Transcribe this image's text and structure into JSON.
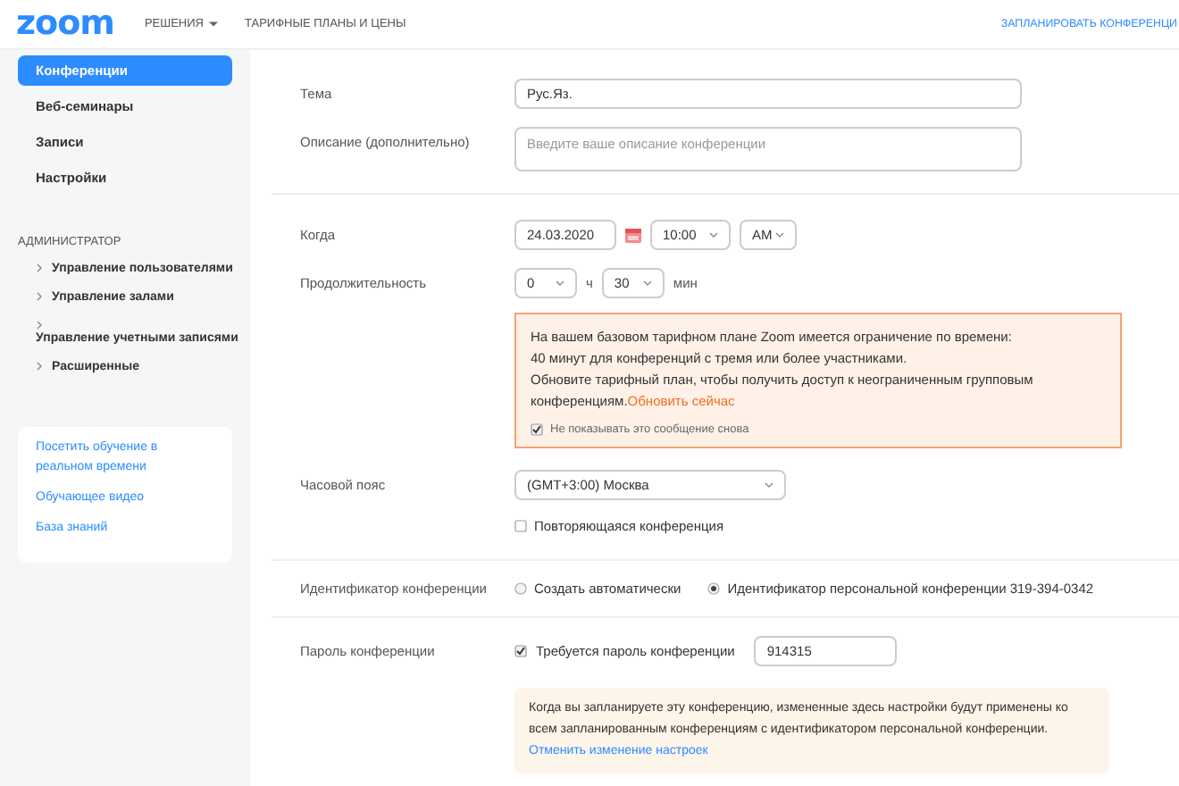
{
  "header": {
    "logo": "zoom",
    "nav": [
      {
        "label": "РЕШЕНИЯ",
        "caret": true
      },
      {
        "label": "ТАРИФНЫЕ ПЛАНЫ И ЦЕНЫ",
        "caret": false
      }
    ],
    "action": "ЗАПЛАНИРОВАТЬ КОНФЕРЕНЦИ"
  },
  "sidebar": {
    "items": [
      {
        "label": "Конференции",
        "selected": true
      },
      {
        "label": "Веб-семинары",
        "selected": false
      },
      {
        "label": "Записи",
        "selected": false
      },
      {
        "label": "Настройки",
        "selected": false
      }
    ],
    "admin_heading": "АДМИНИСТРАТОР",
    "admin_items": [
      {
        "label": "Управление пользователями"
      },
      {
        "label": "Управление залами"
      },
      {
        "label": "Управление учетными записями"
      },
      {
        "label": "Расширенные"
      }
    ],
    "links": [
      "Посетить обучение в реальном времени",
      "Обучающее видео",
      "База знаний"
    ]
  },
  "form": {
    "topic": {
      "label": "Тема",
      "value": "Рус.Яз."
    },
    "description": {
      "label": "Описание (дополнительно)",
      "placeholder": "Введите ваше описание конференции"
    },
    "when": {
      "label": "Когда",
      "date": "24.03.2020",
      "time": "10:00",
      "ampm": "AM"
    },
    "duration": {
      "label": "Продолжительность",
      "hours": "0",
      "hours_unit": "ч",
      "minutes": "30",
      "minutes_unit": "мин"
    },
    "warning": {
      "paragraphs": [
        "На вашем базовом тарифном плане Zoom имеется ограничение по времени:",
        "40 минут для конференций с тремя или более участниками.",
        "Обновите тарифный план, чтобы получить доступ к неограниченным групповым конференциям."
      ],
      "link": "Обновить сейчас",
      "checkbox": {
        "label": "Не показывать это сообщение снова",
        "checked": true
      }
    },
    "timezone": {
      "label": "Часовой пояс",
      "value": "(GMT+3:00) Москва"
    },
    "recurring": {
      "label": "Повторяющаяся конференция",
      "checked": false
    },
    "meeting_id": {
      "label": "Идентификатор конференции",
      "options": [
        {
          "label": "Создать автоматически",
          "selected": false
        },
        {
          "label": "Идентификатор персональной конференции 319-394-0342",
          "selected": true
        }
      ]
    },
    "password": {
      "label": "Пароль конференции",
      "require": {
        "label": "Требуется пароль конференции",
        "checked": true
      },
      "value": "914315"
    },
    "note": {
      "text": "Когда вы запланируете эту конференцию, измененные здесь настройки будут применены ко всем запланированным конференциям с идентификатором персональной конференции.",
      "link": "Отменить изменение настроек"
    }
  }
}
